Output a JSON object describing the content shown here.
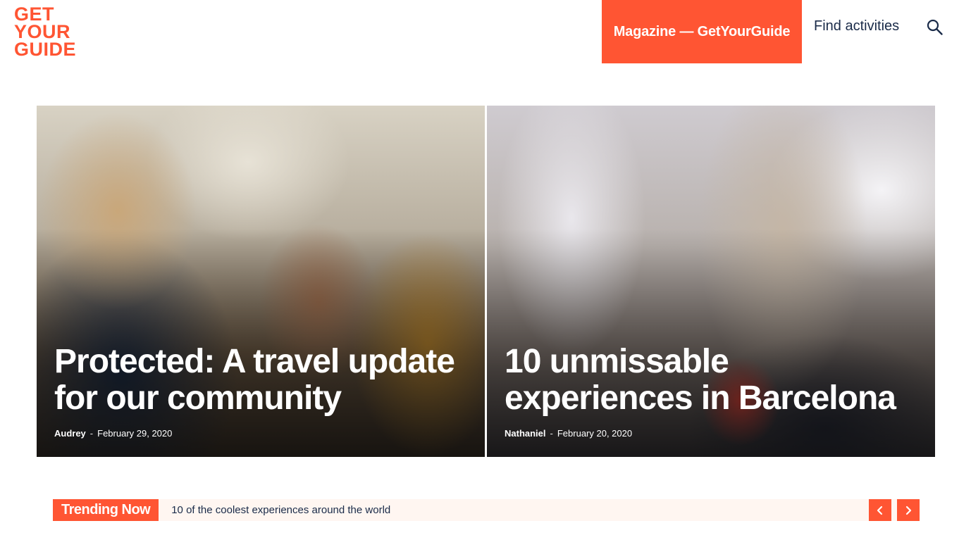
{
  "header": {
    "logo_lines": [
      "GET",
      "YOUR",
      "GUIDE"
    ],
    "nav_magazine": "Magazine — GetYourGuide",
    "nav_find": "Find activities",
    "search_icon": "search-icon"
  },
  "hero": {
    "cards": [
      {
        "title": "Protected: A travel update for our community",
        "author": "Audrey",
        "separator": "-",
        "date": "February 29, 2020"
      },
      {
        "title": "10 unmissable experiences in Barcelona",
        "author": "Nathaniel",
        "separator": "-",
        "date": "February 20, 2020"
      }
    ]
  },
  "trending": {
    "label": "Trending Now",
    "headline": "10 of the coolest experiences around the world",
    "prev_icon": "chevron-left-icon",
    "next_icon": "chevron-right-icon"
  },
  "colors": {
    "brand": "#ff5533",
    "text": "#1a2b49",
    "trending_bg": "#fff6f1"
  }
}
